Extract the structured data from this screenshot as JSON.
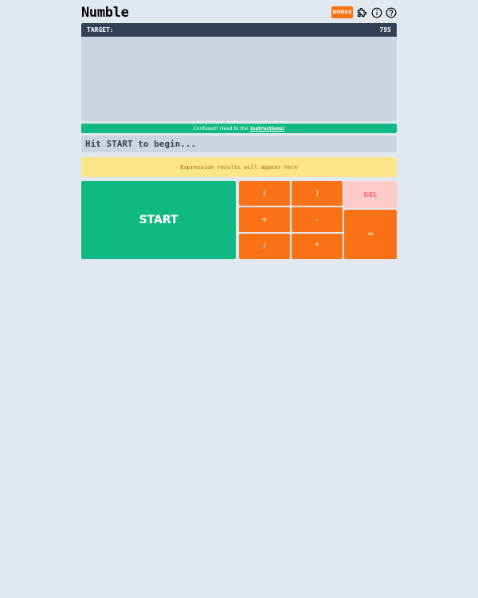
{
  "header": {
    "title": "Numble",
    "bonus_label": "BONUS",
    "icons": [
      "puzzle-icon",
      "info-icon",
      "help-icon"
    ]
  },
  "target": {
    "label": "TARGET:",
    "value": "795"
  },
  "instructions": {
    "prefix": "Confused? Head to the",
    "link": "instructions!"
  },
  "expression": {
    "placeholder": "Hit START to begin..."
  },
  "result": {
    "text": "Expression results will appear here"
  },
  "controls": {
    "start_label": "START",
    "keys": {
      "open_paren": "(",
      "close_paren": ")",
      "del": "DEL",
      "plus": "+",
      "minus": "-",
      "equals": "=",
      "divide": "/",
      "multiply": "*"
    }
  },
  "colors": {
    "background": "#e2e8f0",
    "target_bar": "#334155",
    "board": "#cbd5e1",
    "green": "#10b981",
    "orange": "#f97316",
    "del_bg": "#fecaca",
    "del_text": "#f87171",
    "result_bg": "#fde68a",
    "result_text": "#a16207"
  }
}
